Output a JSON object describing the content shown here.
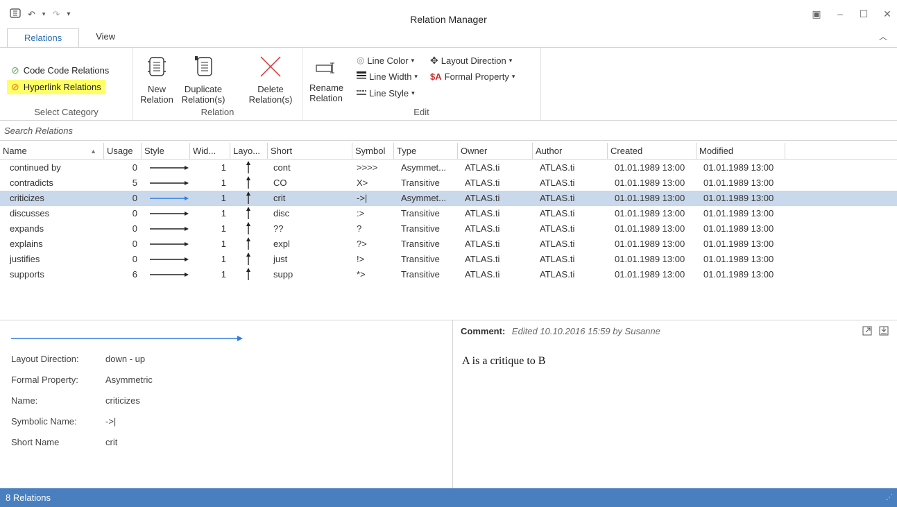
{
  "window": {
    "title": "Relation Manager"
  },
  "quick_access": {
    "app_icon": "app-menu-icon",
    "undo": "undo-icon",
    "redo": "redo-icon",
    "customize": "dropdown-icon"
  },
  "tabs": [
    {
      "label": "Relations"
    },
    {
      "label": "View"
    }
  ],
  "ribbon": {
    "select_category": {
      "caption": "Select Category",
      "items": [
        {
          "label": "Code Code Relations"
        },
        {
          "label": "Hyperlink Relations"
        }
      ]
    },
    "relation": {
      "caption": "Relation",
      "new_label": "New Relation",
      "duplicate_label": "Duplicate Relation(s)",
      "delete_label": "Delete Relation(s)"
    },
    "edit": {
      "caption": "Edit",
      "rename_label": "Rename Relation",
      "line_color": "Line Color",
      "line_width": "Line Width",
      "line_style": "Line Style",
      "layout_direction": "Layout Direction",
      "formal_property": "Formal Property"
    }
  },
  "search": {
    "placeholder": "Search Relations"
  },
  "table": {
    "columns": [
      {
        "label": "Name"
      },
      {
        "label": "Usage"
      },
      {
        "label": "Style"
      },
      {
        "label": "Wid..."
      },
      {
        "label": "Layo..."
      },
      {
        "label": "Short"
      },
      {
        "label": "Symbol"
      },
      {
        "label": "Type"
      },
      {
        "label": "Owner"
      },
      {
        "label": "Author"
      },
      {
        "label": "Created"
      },
      {
        "label": "Modified"
      }
    ],
    "rows": [
      {
        "name": "continued by",
        "usage": "0",
        "width": "1",
        "short": "cont",
        "symbol": ">>>>",
        "type": "Asymmet...",
        "owner": "ATLAS.ti",
        "author": "ATLAS.ti",
        "created": "01.01.1989 13:00",
        "modified": "01.01.1989 13:00"
      },
      {
        "name": "contradicts",
        "usage": "5",
        "width": "1",
        "short": "CO",
        "symbol": "X>",
        "type": "Transitive",
        "owner": "ATLAS.ti",
        "author": "ATLAS.ti",
        "created": "01.01.1989 13:00",
        "modified": "01.01.1989 13:00"
      },
      {
        "name": "criticizes",
        "usage": "0",
        "width": "1",
        "short": "crit",
        "symbol": "->|",
        "type": "Asymmet...",
        "owner": "ATLAS.ti",
        "author": "ATLAS.ti",
        "created": "01.01.1989 13:00",
        "modified": "01.01.1989 13:00"
      },
      {
        "name": "discusses",
        "usage": "0",
        "width": "1",
        "short": "disc",
        "symbol": ":>",
        "type": "Transitive",
        "owner": "ATLAS.ti",
        "author": "ATLAS.ti",
        "created": "01.01.1989 13:00",
        "modified": "01.01.1989 13:00"
      },
      {
        "name": "expands",
        "usage": "0",
        "width": "1",
        "short": "??",
        "symbol": "?",
        "type": "Transitive",
        "owner": "ATLAS.ti",
        "author": "ATLAS.ti",
        "created": "01.01.1989 13:00",
        "modified": "01.01.1989 13:00"
      },
      {
        "name": "explains",
        "usage": "0",
        "width": "1",
        "short": "expl",
        "symbol": "?>",
        "type": "Transitive",
        "owner": "ATLAS.ti",
        "author": "ATLAS.ti",
        "created": "01.01.1989 13:00",
        "modified": "01.01.1989 13:00"
      },
      {
        "name": "justifies",
        "usage": "0",
        "width": "1",
        "short": "just",
        "symbol": "!>",
        "type": "Transitive",
        "owner": "ATLAS.ti",
        "author": "ATLAS.ti",
        "created": "01.01.1989 13:00",
        "modified": "01.01.1989 13:00"
      },
      {
        "name": "supports",
        "usage": "6",
        "width": "1",
        "short": "supp",
        "symbol": "*>",
        "type": "Transitive",
        "owner": "ATLAS.ti",
        "author": "ATLAS.ti",
        "created": "01.01.1989 13:00",
        "modified": "01.01.1989 13:00"
      }
    ]
  },
  "details": {
    "layout_direction": {
      "label": "Layout Direction:",
      "value": "down - up"
    },
    "formal_property": {
      "label": "Formal Property:",
      "value": "Asymmetric"
    },
    "name": {
      "label": "Name:",
      "value": "criticizes"
    },
    "symbolic_name": {
      "label": "Symbolic Name:",
      "value": "->|"
    },
    "short_name": {
      "label": "Short Name",
      "value": "crit"
    }
  },
  "comment": {
    "label": "Comment:",
    "meta": "Edited 10.10.2016 15:59 by Susanne",
    "text": "A is a critique to B"
  },
  "status": {
    "text": "8 Relations"
  },
  "colors": {
    "accent": "#4a7fbf",
    "selected_row": "#c9d8ea",
    "highlight": "#ffff66",
    "delete_red": "#e04040",
    "selected_line": "#2f7de1"
  }
}
